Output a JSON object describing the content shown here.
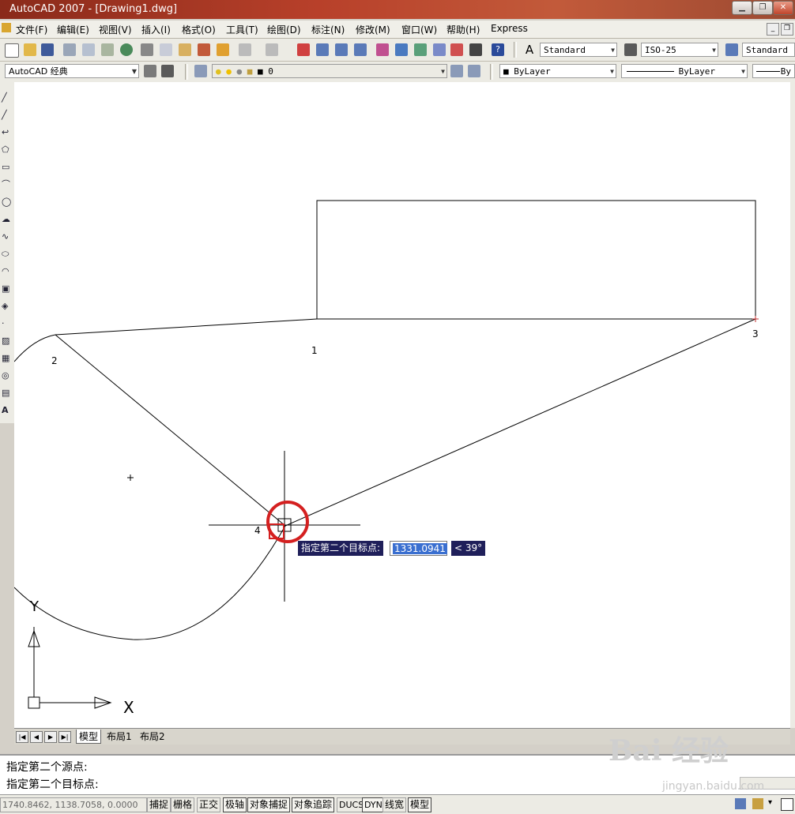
{
  "window": {
    "title": "AutoCAD 2007 - [Drawing1.dwg]"
  },
  "menu": {
    "items": [
      "文件(F)",
      "编辑(E)",
      "视图(V)",
      "插入(I)",
      "格式(O)",
      "工具(T)",
      "绘图(D)",
      "标注(N)",
      "修改(M)",
      "窗口(W)",
      "帮助(H)",
      "Express"
    ]
  },
  "styles_toolbar": {
    "text_style": "Standard",
    "dim_style": "ISO-25",
    "table_style": "Standard"
  },
  "workspace": {
    "name": "AutoCAD 经典"
  },
  "layers": {
    "current": "0"
  },
  "properties": {
    "color": "ByLayer",
    "linetype": "ByLayer",
    "lineweight": "By"
  },
  "drawing": {
    "labels": [
      "1",
      "2",
      "3",
      "4"
    ],
    "ucs_x": "X",
    "ucs_y": "Y"
  },
  "dynamic_input": {
    "prompt": "指定第二个目标点:",
    "distance": "1331.0941",
    "angle": "< 39°"
  },
  "layout_tabs": [
    "模型",
    "布局1",
    "布局2"
  ],
  "command_history": [
    "指定第二个源点:",
    "指定第二个目标点:"
  ],
  "status": {
    "coordinates": "1740.8462,  1138.7058,  0.0000",
    "toggles": [
      "捕捉",
      "栅格",
      "正交",
      "极轴",
      "对象捕捉",
      "对象追踪",
      "DUCS",
      "DYN",
      "线宽",
      "模型"
    ]
  },
  "watermark": {
    "brand": "Bai 经验",
    "url": "jingyan.baidu.com"
  },
  "colors": {
    "accent_annotation": "#d42020",
    "tooltip_bg": "#1f1f5a",
    "selection": "#3a6fd0"
  }
}
